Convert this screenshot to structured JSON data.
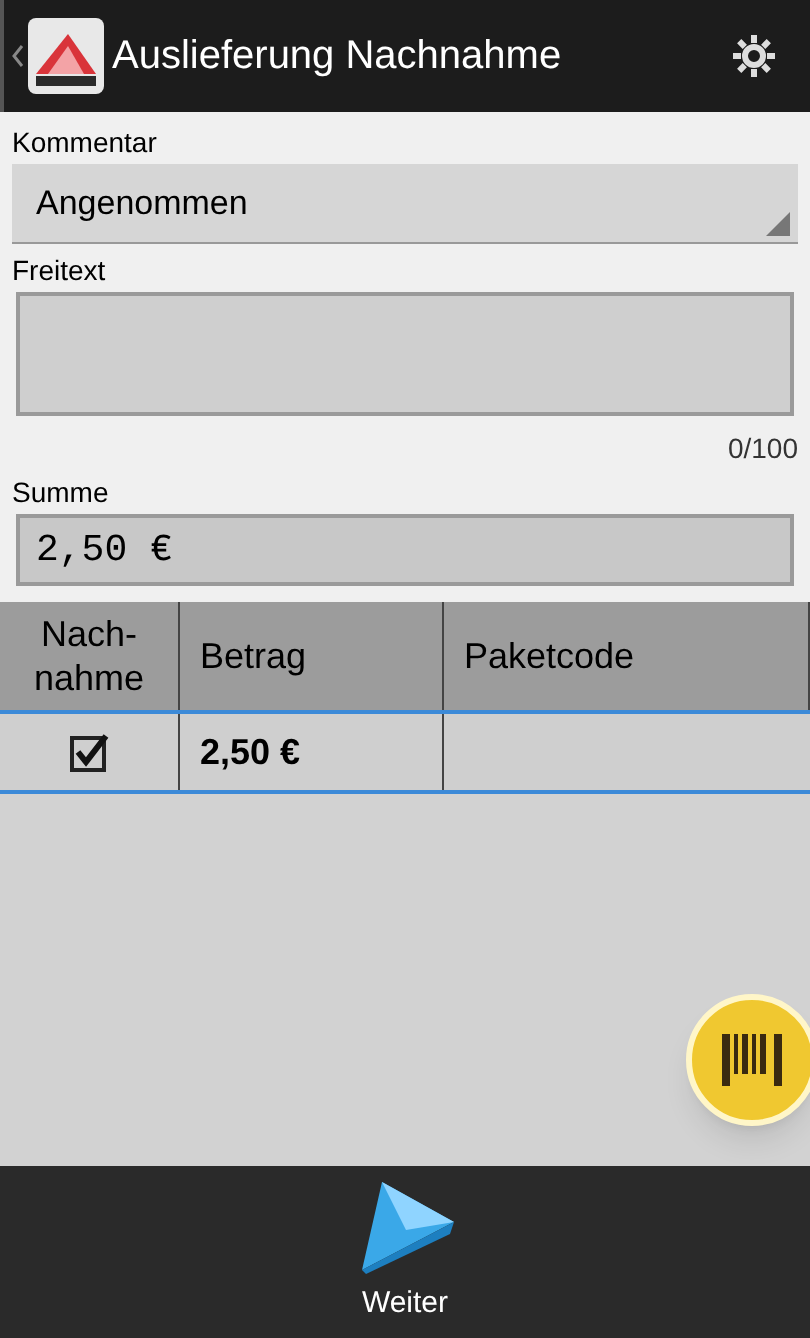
{
  "header": {
    "title": "Auslieferung Nachnahme"
  },
  "comment": {
    "label": "Kommentar",
    "value": "Angenommen"
  },
  "freitext": {
    "label": "Freitext",
    "counter": "0/100"
  },
  "summe": {
    "label": "Summe",
    "value": "2,50 €"
  },
  "table": {
    "columns": [
      "Nach-\nnahme",
      "Betrag",
      "Paketcode"
    ],
    "rows": [
      {
        "selected": true,
        "checked": true,
        "betrag": "2,50 €"
      }
    ]
  },
  "bottom": {
    "next_label": "Weiter"
  }
}
